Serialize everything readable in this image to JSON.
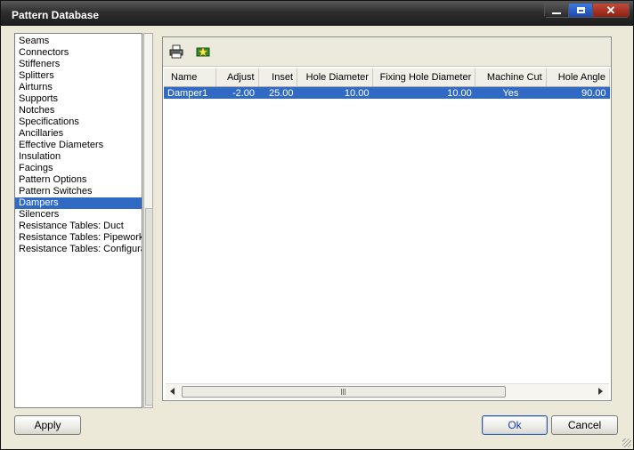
{
  "window": {
    "title": "Pattern Database"
  },
  "sidebar": {
    "items": [
      {
        "label": "Seams",
        "selected": false
      },
      {
        "label": "Connectors",
        "selected": false
      },
      {
        "label": "Stiffeners",
        "selected": false
      },
      {
        "label": "Splitters",
        "selected": false
      },
      {
        "label": "Airturns",
        "selected": false
      },
      {
        "label": "Supports",
        "selected": false
      },
      {
        "label": "Notches",
        "selected": false
      },
      {
        "label": "Specifications",
        "selected": false
      },
      {
        "label": "Ancillaries",
        "selected": false
      },
      {
        "label": "Effective Diameters",
        "selected": false
      },
      {
        "label": "Insulation",
        "selected": false
      },
      {
        "label": "Facings",
        "selected": false
      },
      {
        "label": "Pattern Options",
        "selected": false
      },
      {
        "label": "Pattern Switches",
        "selected": false
      },
      {
        "label": "Dampers",
        "selected": true
      },
      {
        "label": "Silencers",
        "selected": false
      },
      {
        "label": "Resistance Tables: Duct",
        "selected": false
      },
      {
        "label": "Resistance Tables: Pipework",
        "selected": false
      },
      {
        "label": "Resistance Tables: Configura",
        "selected": false
      }
    ]
  },
  "toolbar": {
    "icons": [
      "print-icon",
      "new-item-icon"
    ]
  },
  "table": {
    "columns": [
      "Name",
      "Adjust",
      "Inset",
      "Hole Diameter",
      "Fixing Hole Diameter",
      "Machine Cut",
      "Hole Angle"
    ],
    "rows": [
      [
        "Damper1",
        "-2.00",
        "25.00",
        "10.00",
        "10.00",
        "Yes",
        "90.00"
      ]
    ]
  },
  "buttons": {
    "apply": "Apply",
    "ok": "Ok",
    "cancel": "Cancel"
  }
}
